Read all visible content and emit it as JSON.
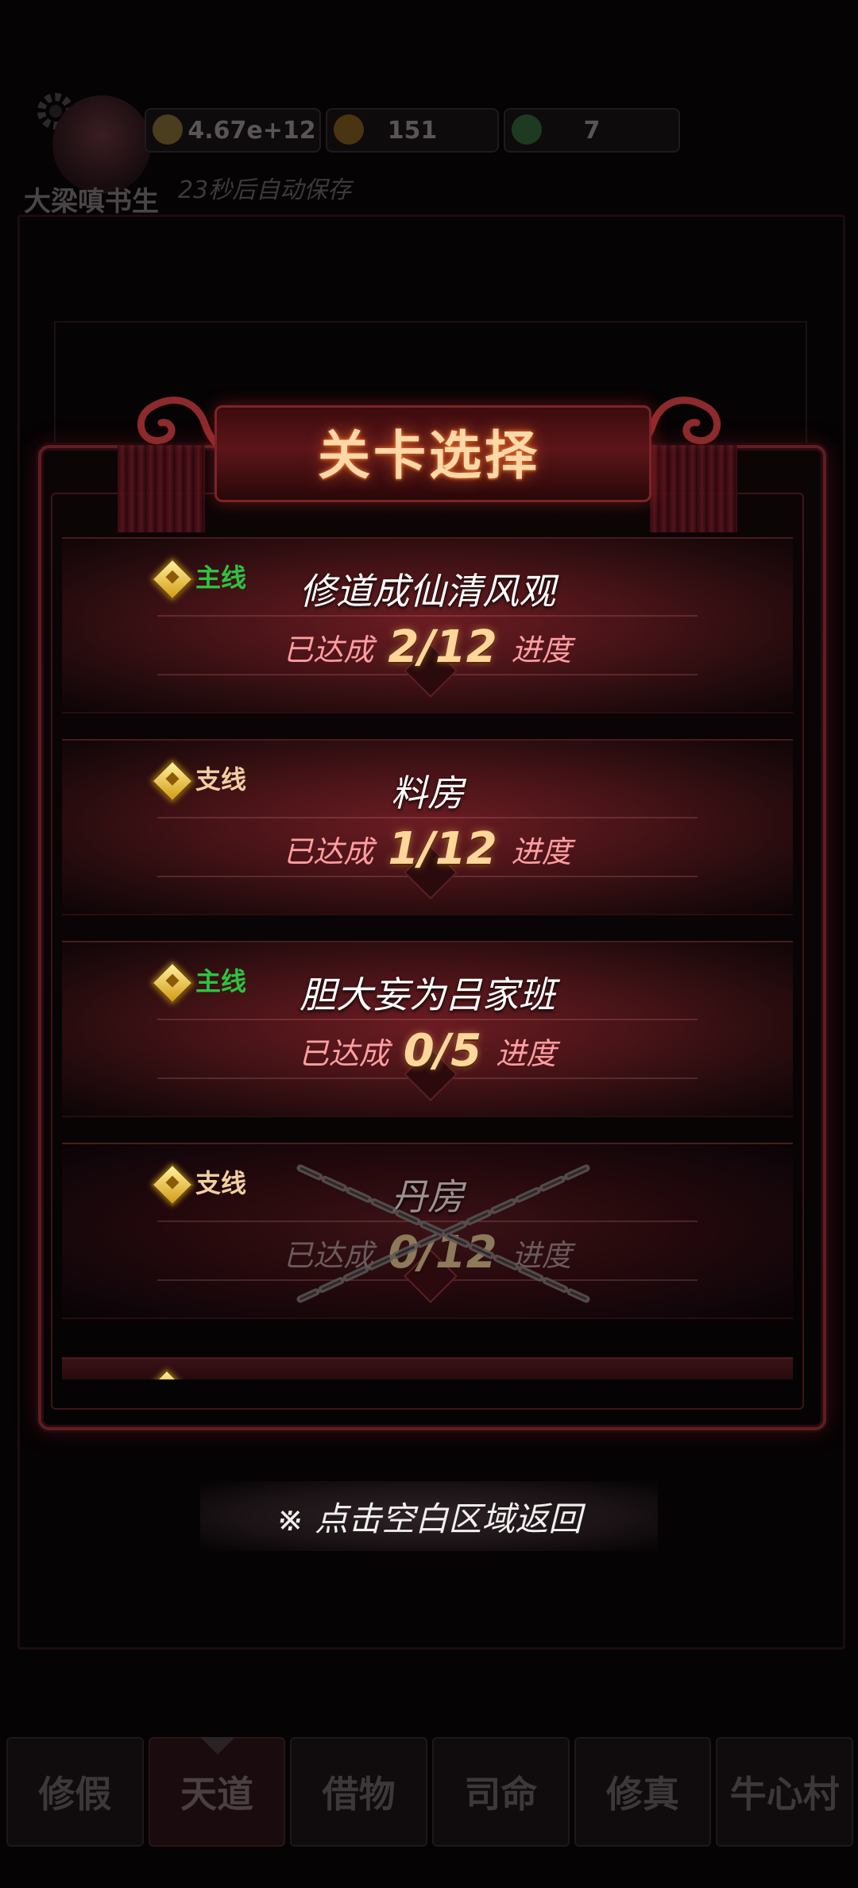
{
  "player": {
    "name": "大梁嗔书生"
  },
  "resources": [
    {
      "icon": "gold-coin-icon",
      "value": "4.67e+12"
    },
    {
      "icon": "flame-coin-icon",
      "value": "151"
    },
    {
      "icon": "jade-icon",
      "value": "7"
    }
  ],
  "autosave_text": "23秒后自动保存",
  "modal": {
    "title": "关卡选择",
    "progress_prefix": "已达成",
    "progress_suffix": "进度",
    "levels": [
      {
        "tag": "主线",
        "tag_type": "main",
        "title": "修道成仙清风观",
        "progress": "2/12",
        "locked": false
      },
      {
        "tag": "支线",
        "tag_type": "side",
        "title": "料房",
        "progress": "1/12",
        "locked": false
      },
      {
        "tag": "主线",
        "tag_type": "main",
        "title": "胆大妄为吕家班",
        "progress": "0/5",
        "locked": false
      },
      {
        "tag": "支线",
        "tag_type": "side",
        "title": "丹房",
        "progress": "0/12",
        "locked": true
      }
    ]
  },
  "return_hint": "※ 点击空白区域返回",
  "bottom_nav": {
    "active_index": 1,
    "tabs": [
      "修假",
      "天道",
      "借物",
      "司命",
      "修真",
      "牛心村"
    ]
  },
  "colors": {
    "main_tag": "#2ec43c",
    "side_tag": "#f1cfa0",
    "progress_value": "#ffd79a",
    "progress_label": "#ff9ea0",
    "title_glow": "#ff7a30"
  }
}
